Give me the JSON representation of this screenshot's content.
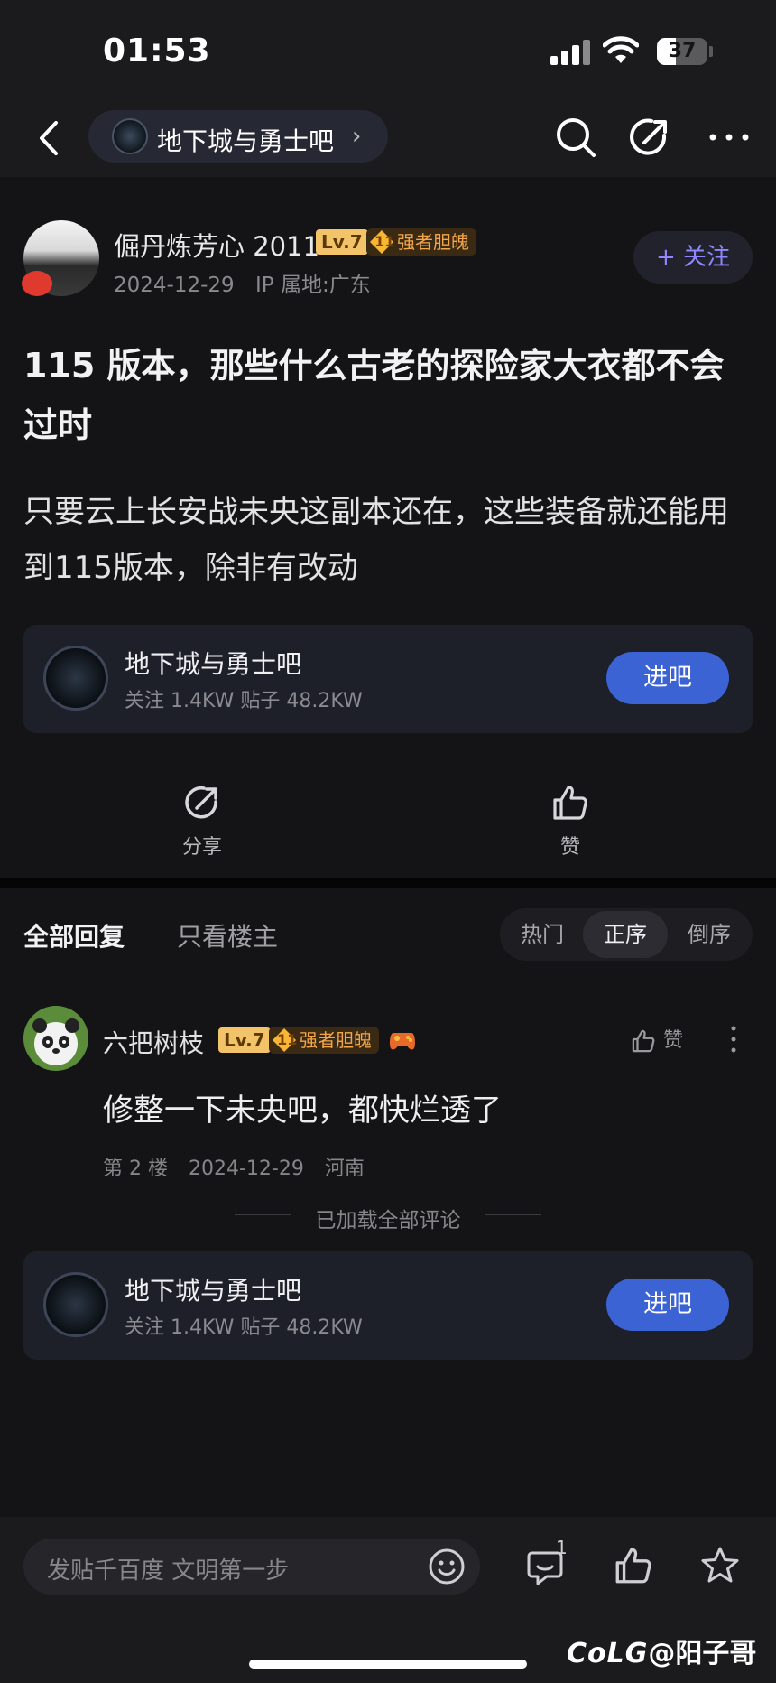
{
  "status_bar": {
    "time": "01:53",
    "battery": "37"
  },
  "nav": {
    "forum_name": "地下城与勇士吧",
    "chevron": "›"
  },
  "post": {
    "author": {
      "name": "倔丹炼芳心 2011",
      "level": "Lv.7",
      "medal_level": "11",
      "medal": "强者胆魄",
      "date": "2024-12-29",
      "ip": "IP 属地:广东"
    },
    "follow_label": "+ 关注",
    "title": "115 版本，那些什么古老的探险家大衣都不会过时",
    "body": "只要云上长安战未央这副本还在，这些装备就还能用到115版本，除非有改动"
  },
  "forum_card": {
    "name": "地下城与勇士吧",
    "stats": "关注 1.4KW   贴子 48.2KW",
    "enter_label": "进吧"
  },
  "actions": {
    "share": "分享",
    "like": "赞"
  },
  "replies": {
    "tab_all": "全部回复",
    "tab_op": "只看楼主",
    "sort": [
      "热门",
      "正序",
      "倒序"
    ],
    "sort_active": "正序",
    "comments": [
      {
        "name": "六把树枝",
        "level": "Lv.7",
        "medal_level": "11",
        "medal": "强者胆魄",
        "like_label": "赞",
        "text": "修整一下未央吧，都快烂透了",
        "floor": "第 2 楼",
        "date": "2024-12-29",
        "location": "河南"
      }
    ],
    "loaded_all": "已加载全部评论"
  },
  "bottom_bar": {
    "placeholder": "发贴千百度 文明第一步",
    "comment_count": "1"
  },
  "watermark": {
    "logo": "CoLG",
    "handle": "@阳子哥"
  },
  "colors": {
    "accent": "#3b63d4",
    "follow": "#8e87ff",
    "medal": "#f3a64a",
    "level": "#f3c36a"
  }
}
